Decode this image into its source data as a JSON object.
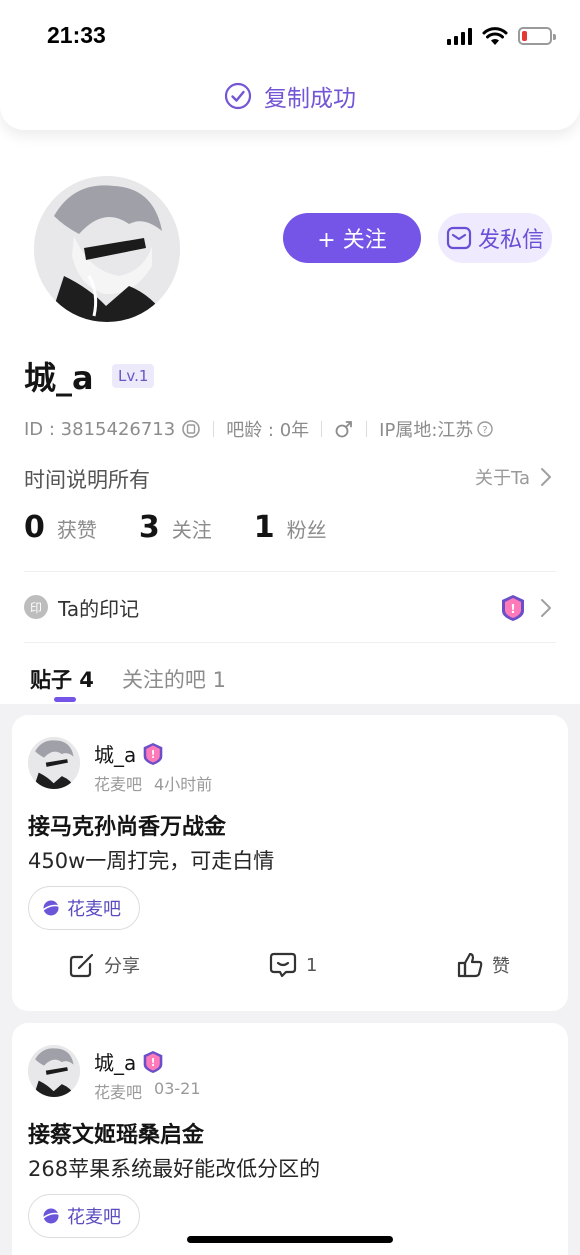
{
  "status_bar": {
    "time": "21:33",
    "battery_level": 0.18,
    "battery_color": "#e53935"
  },
  "toast": {
    "text": "复制成功",
    "icon": "check-circle-icon"
  },
  "profile": {
    "name": "城_a",
    "level": "Lv.1",
    "follow_label": "+ 关注",
    "dm_label": "发私信",
    "id_text": "ID : 3815426713",
    "bar_age": "吧龄 : 0年",
    "gender_icon": "male-icon",
    "ip_location": "IP属地:江苏",
    "bio": "时间说明所有",
    "about_label": "关于Ta"
  },
  "stats": [
    {
      "num": "0",
      "label": "获赞"
    },
    {
      "num": "3",
      "label": "关注"
    },
    {
      "num": "1",
      "label": "粉丝"
    }
  ],
  "marks": {
    "icon_text": "印",
    "label": "Ta的印记"
  },
  "tabs": [
    {
      "label": "贴子 4",
      "active": true
    },
    {
      "label": "关注的吧 1",
      "active": false
    }
  ],
  "posts": [
    {
      "author": "城_a",
      "forum": "花麦吧",
      "time": "4小时前",
      "title": "接马克孙尚香万战金",
      "body": "450w一周打完，可走白情",
      "tag": "花麦吧",
      "share_label": "分享",
      "comment_count": "1",
      "like_label": "赞"
    },
    {
      "author": "城_a",
      "forum": "花麦吧",
      "time": "03-21",
      "title": "接蔡文姬瑶桑启金",
      "body": "268苹果系统最好能改低分区的",
      "tag": "花麦吧"
    }
  ],
  "colors": {
    "accent": "#7455e8",
    "accent_light": "#efeafd",
    "feed_bg": "#f2f2f4"
  }
}
